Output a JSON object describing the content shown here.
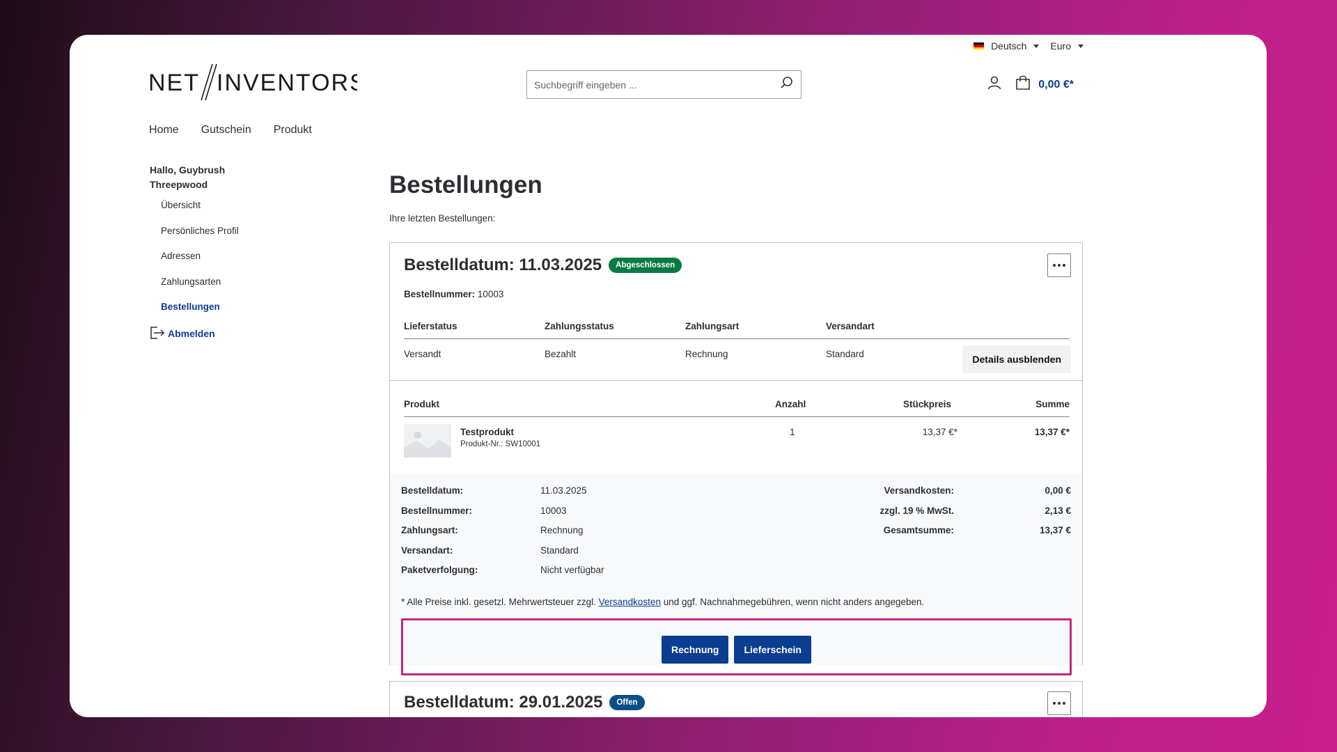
{
  "topbar": {
    "language": "Deutsch",
    "currency": "Euro",
    "flag_colors": [
      "#000000",
      "#dd0000",
      "#ffce00"
    ]
  },
  "header": {
    "logo_left": "NET",
    "logo_right": "INVENTORS",
    "search_placeholder": "Suchbegriff eingeben ...",
    "cart_total": "0,00 €*",
    "icons": [
      "search-icon",
      "user-icon",
      "cart-icon"
    ]
  },
  "nav": {
    "items": [
      "Home",
      "Gutschein",
      "Produkt"
    ]
  },
  "sidebar": {
    "greeting": "Hallo, Guybrush Threepwood",
    "items": [
      "Übersicht",
      "Persönliches Profil",
      "Adressen",
      "Zahlungsarten",
      "Bestellungen"
    ],
    "active_item": "Bestellungen",
    "logout": "Abmelden"
  },
  "main": {
    "title": "Bestellungen",
    "subtitle": "Ihre letzten Bestellungen:"
  },
  "order1": {
    "date_label": "Bestelldatum: 11.03.2025",
    "status_badge": "Abgeschlossen",
    "badge_color": "#0a7a43",
    "number_label": "Bestellnummer:",
    "number": "10003",
    "status_headers": [
      "Lieferstatus",
      "Zahlungsstatus",
      "Zahlungsart",
      "Versandart"
    ],
    "status_values": [
      "Versandt",
      "Bezahlt",
      "Rechnung",
      "Standard"
    ],
    "details_button": "Details ausblenden",
    "product_headers": [
      "Produkt",
      "Anzahl",
      "Stückpreis",
      "Summe"
    ],
    "product": {
      "name": "Testprodukt",
      "sku": "Produkt-Nr.: SW10001",
      "qty": "1",
      "unit_price": "13,37 €*",
      "total": "13,37 €*"
    },
    "summary_left": [
      {
        "k": "Bestelldatum:",
        "v": "11.03.2025"
      },
      {
        "k": "Bestellnummer:",
        "v": "10003"
      },
      {
        "k": "Zahlungsart:",
        "v": "Rechnung"
      },
      {
        "k": "Versandart:",
        "v": "Standard"
      },
      {
        "k": "Paketverfolgung:",
        "v": "Nicht verfügbar"
      }
    ],
    "summary_right": [
      {
        "k": "Versandkosten:",
        "v": "0,00 €"
      },
      {
        "k": "zzgl. 19 % MwSt.",
        "v": "2,13 €"
      },
      {
        "k": "Gesamtsumme:",
        "v": "13,37 €"
      }
    ],
    "note_prefix": "* Alle Preise inkl. gesetzl. Mehrwertsteuer zzgl.",
    "note_link": "Versandkosten",
    "note_suffix": "und ggf. Nachnahmegebühren, wenn nicht anders angegeben.",
    "invoice_button": "Rechnung",
    "delivery_button": "Lieferschein"
  },
  "order2": {
    "date_label": "Bestelldatum: 29.01.2025",
    "status_badge": "Offen",
    "badge_color": "#0b4f8a"
  },
  "colors": {
    "brand_blue": "#0b3d91",
    "highlight": "#c2267f"
  }
}
